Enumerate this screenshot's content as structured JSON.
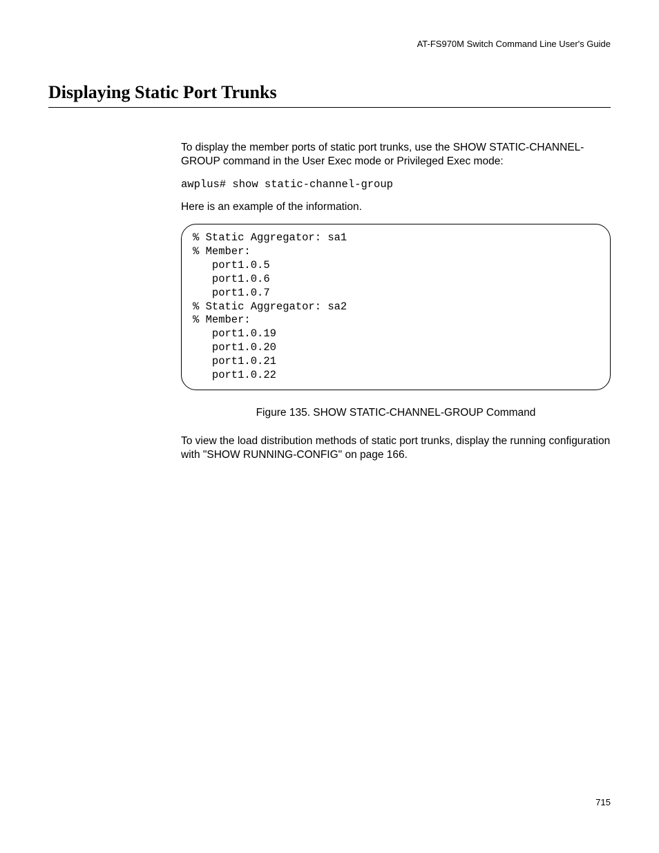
{
  "header": {
    "guide_title": "AT-FS970M Switch Command Line User's Guide"
  },
  "section": {
    "title": "Displaying Static Port Trunks"
  },
  "intro": {
    "text": "To display the member ports of static port trunks, use the SHOW STATIC-CHANNEL-GROUP command in the User Exec mode or Privileged Exec mode:"
  },
  "command": {
    "text": "awplus# show static-channel-group"
  },
  "example_intro": {
    "text": "Here is an example of the information."
  },
  "output": {
    "lines": "% Static Aggregator: sa1\n% Member:\n   port1.0.5\n   port1.0.6\n   port1.0.7\n% Static Aggregator: sa2\n% Member:\n   port1.0.19\n   port1.0.20\n   port1.0.21\n   port1.0.22"
  },
  "figure": {
    "caption": "Figure 135. SHOW STATIC-CHANNEL-GROUP Command"
  },
  "closing": {
    "text": "To view the load distribution methods of static port trunks, display the running configuration with \"SHOW RUNNING-CONFIG\" on page 166."
  },
  "footer": {
    "page_number": "715"
  }
}
